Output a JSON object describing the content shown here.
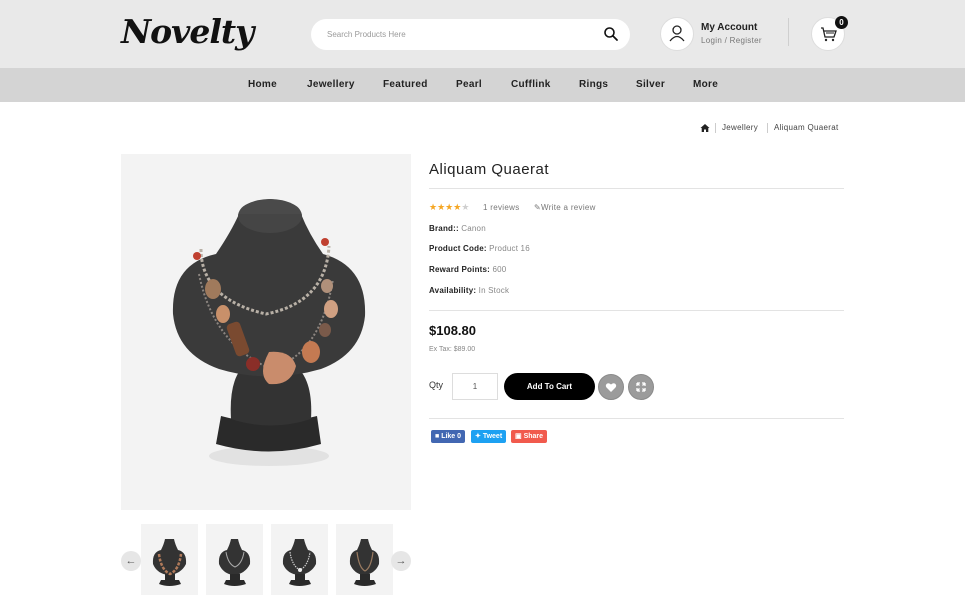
{
  "header": {
    "logo_text": "Novelty",
    "search": {
      "placeholder": "Search Products Here"
    },
    "account": {
      "title": "My Account",
      "subtitle": "Login / Register"
    },
    "cart": {
      "count": "0"
    }
  },
  "nav": {
    "items": [
      "Home",
      "Jewellery",
      "Featured",
      "Pearl",
      "Cufflink",
      "Rings",
      "Silver",
      "More"
    ]
  },
  "breadcrumb": {
    "home_icon": "home-icon",
    "items": [
      "Jewellery",
      "Aliquam Quaerat"
    ]
  },
  "product": {
    "title": "Aliquam Quaerat",
    "rating": 4,
    "rating_max": 5,
    "reviews": "1 reviews",
    "write_review": "Write a review",
    "brand_label": "Brand::",
    "brand_value": "Canon",
    "code_label": "Product Code:",
    "code_value": "Product 16",
    "points_label": "Reward Points:",
    "points_value": "600",
    "availability_label": "Availability:",
    "availability_value": "In Stock",
    "price": "$108.80",
    "ex_tax": "Ex Tax: $89.00",
    "qty_label": "Qty",
    "qty_value": "1",
    "add_to_cart": "Add To Cart"
  },
  "social": {
    "like": "Like 0",
    "tweet": "Tweet",
    "share": "Share",
    "colors": {
      "facebook": "#4267b2",
      "twitter": "#1da1f2",
      "share": "#f15a4d"
    }
  },
  "colors": {
    "accent": "#000000",
    "star": "#f5a623",
    "header_bg": "#e9e9e9",
    "nav_bg": "#d4d4d4"
  }
}
